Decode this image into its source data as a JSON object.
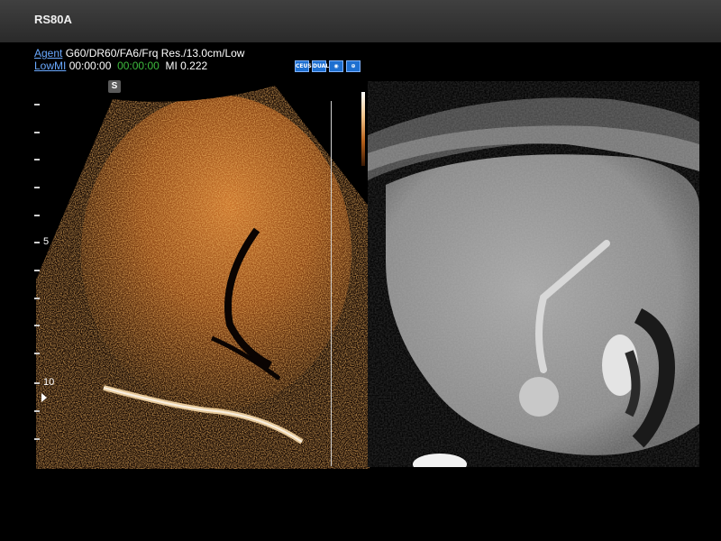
{
  "header": {
    "title": "RS80A"
  },
  "info_row1": {
    "agent_link": "Agent",
    "params": "G60/DR60/FA6/Frq Res./13.0cm/Low"
  },
  "info_row2": {
    "lowmi_link": "LowMI",
    "timer_white": "00:00:00",
    "timer_green": "00:00:00",
    "mi": "MI 0.222"
  },
  "toolbar_icons": [
    "contrast-icon",
    "dual-icon",
    "probe-icon",
    "target-icon"
  ],
  "toolbar_icon_glyphs": [
    "CEUS",
    "DUAL",
    "◉",
    "⊕"
  ],
  "scan_marker": "S",
  "depth_labels": {
    "five": "5",
    "ten": "10"
  },
  "colors": {
    "link": "#6aa9ff",
    "timer_green": "#3dbb3d",
    "contrast_orange": "#b8601a",
    "toolbar_blue": "#1e6fd0"
  }
}
